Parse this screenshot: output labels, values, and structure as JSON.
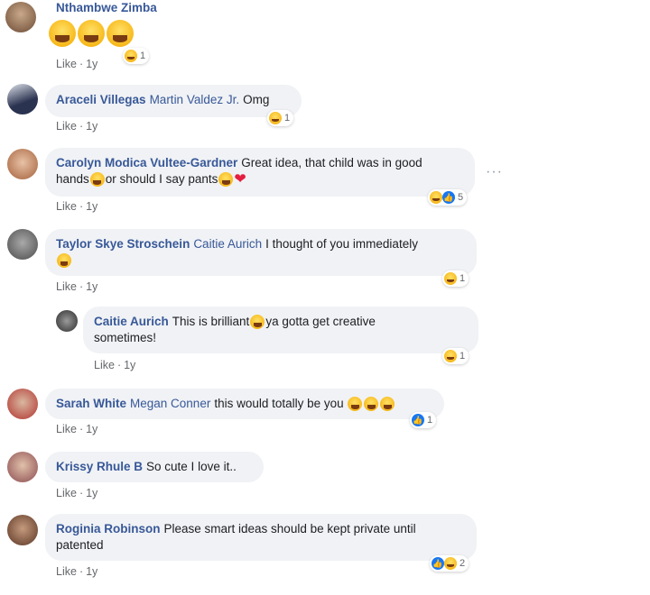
{
  "comments": [
    {
      "author": "Nthambwe Zimba",
      "mention": "",
      "text": "",
      "like": "Like",
      "time": "1y",
      "react_count": "1"
    },
    {
      "author": "Araceli Villegas",
      "mention": "Martin Valdez Jr.",
      "text": "Omg",
      "like": "Like",
      "time": "1y",
      "react_count": "1"
    },
    {
      "author": "Carolyn Modica Vultee-Gardner",
      "mention": "",
      "text1": "Great idea, that child was in good",
      "text2a": "hands",
      "text2b": "or should I say pants",
      "like": "Like",
      "time": "1y",
      "react_count": "5"
    },
    {
      "author": "Taylor Skye Stroschein",
      "mention": "Caitie Aurich",
      "text": "I thought of you immediately",
      "like": "Like",
      "time": "1y",
      "react_count": "1"
    },
    {
      "author": "Caitie Aurich",
      "mention": "",
      "text1": "This is brilliant",
      "text1b": "ya gotta get creative",
      "text2": "sometimes!",
      "like": "Like",
      "time": "1y",
      "react_count": "1"
    },
    {
      "author": "Sarah White",
      "mention": "Megan Conner",
      "text": "this would totally be you",
      "like": "Like",
      "time": "1y",
      "react_count": "1"
    },
    {
      "author": "Krissy Rhule B",
      "mention": "",
      "text": "So cute I love it..",
      "like": "Like",
      "time": "1y"
    },
    {
      "author": "Roginia Robinson",
      "mention": "",
      "text1": "Please smart ideas should be kept private until",
      "text2": "patented",
      "like": "Like",
      "time": "1y",
      "react_count": "2"
    }
  ],
  "more_glyph": "···",
  "colors": {
    "author": "#385898",
    "bubble": "#f0f2f5",
    "meta": "#65676b"
  }
}
